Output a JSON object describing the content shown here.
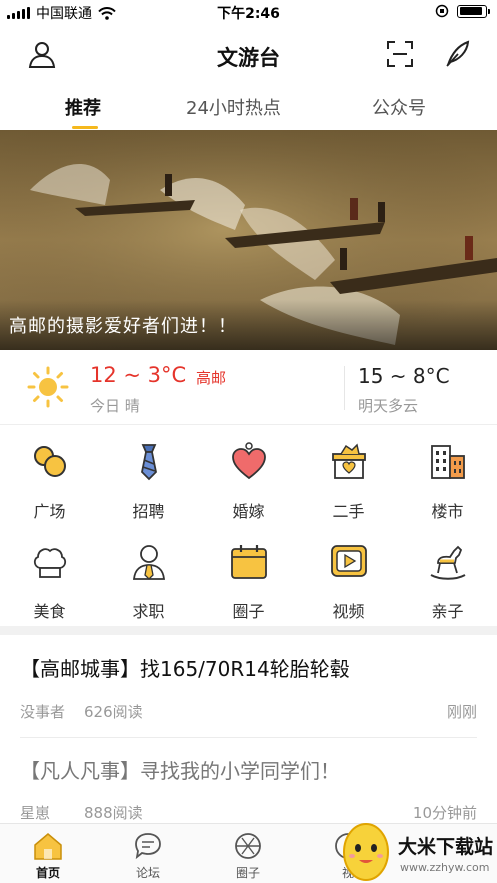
{
  "status_bar": {
    "carrier": "中国联通",
    "time": "下午2:46",
    "battery_level": 0.9
  },
  "nav": {
    "title": "文游台",
    "left_icon": "user-icon",
    "right_icons": [
      "scan-icon",
      "feather-pen-icon"
    ]
  },
  "tabs": [
    {
      "label": "推荐",
      "active": true
    },
    {
      "label": "24小时热点",
      "active": false
    },
    {
      "label": "公众号",
      "active": false
    }
  ],
  "banner": {
    "caption": "高邮的摄影爱好者们进！！"
  },
  "weather": {
    "icon": "sun-icon",
    "today_temp": "12 ~ 3°C",
    "city": "高邮",
    "today_desc": "今日 晴",
    "tomorrow_temp": "15 ~ 8°C",
    "tomorrow_desc": "明天多云"
  },
  "categories": [
    {
      "label": "广场",
      "icon": "plaza-icon"
    },
    {
      "label": "招聘",
      "icon": "tie-icon"
    },
    {
      "label": "婚嫁",
      "icon": "heart-icon"
    },
    {
      "label": "二手",
      "icon": "secondhand-box-icon"
    },
    {
      "label": "楼市",
      "icon": "building-icon"
    },
    {
      "label": "美食",
      "icon": "chef-hat-icon"
    },
    {
      "label": "求职",
      "icon": "job-seeker-icon"
    },
    {
      "label": "圈子",
      "icon": "calendar-icon"
    },
    {
      "label": "视频",
      "icon": "video-play-icon"
    },
    {
      "label": "亲子",
      "icon": "rocking-horse-icon"
    }
  ],
  "news": [
    {
      "title": "【高邮城事】找165/70R14轮胎轮毂",
      "author": "没事者",
      "reads": "626阅读",
      "time": "刚刚"
    },
    {
      "title": "【凡人凡事】寻找我的小学同学们！",
      "author": "星崽",
      "reads": "888阅读",
      "time": "10分钟前"
    }
  ],
  "tabbar": [
    {
      "label": "首页",
      "icon": "home-icon",
      "active": true
    },
    {
      "label": "论坛",
      "icon": "chat-bubble-icon",
      "active": false
    },
    {
      "label": "圈子",
      "icon": "aperture-icon",
      "active": false
    },
    {
      "label": "视",
      "icon": "video-icon",
      "active": false
    }
  ],
  "watermark": {
    "name": "大米下载站",
    "url": "www.zzhyw.com"
  },
  "colors": {
    "accent": "#f5b81c",
    "temp_red": "#e5342b"
  }
}
